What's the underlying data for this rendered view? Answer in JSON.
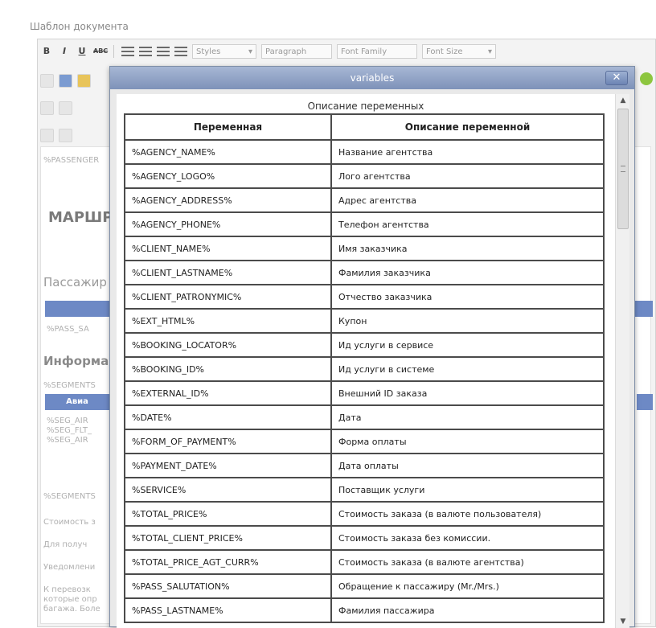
{
  "page": {
    "title": "Шаблон документа"
  },
  "toolbar": {
    "bold": "B",
    "italic": "I",
    "underline": "U",
    "strike": "ABC",
    "styles": "Styles",
    "paragraph": "Paragraph",
    "font_family": "Font Family",
    "font_size": "Font Size"
  },
  "editor": {
    "var_passenger": "%PASSENGER",
    "heading_route": "МАРШР",
    "heading_passengers": "Пассажир",
    "var_pass_sa": "%PASS_SA",
    "heading_info": "Информац",
    "var_segments": "%SEGMENTS",
    "col_flight": "Авиа",
    "var_seg_air": "%SEG_AIR",
    "var_seg_flt": "%SEG_FLT_",
    "var_seg_air2": "%SEG_AIR",
    "var_segments2": "%SEGMENTS",
    "text_cost": "Стоимость з",
    "text_get": "Для получ",
    "text_notice": "Уведомлени",
    "text_carrier": "К перевозк",
    "text_which": "которые опр",
    "text_baggage": "багажа. Боле"
  },
  "modal": {
    "title": "variables",
    "close": "✕",
    "caption": "Описание переменных",
    "headers": [
      "Переменная",
      "Описание переменной"
    ],
    "rows": [
      [
        "%AGENCY_NAME%",
        "Название агентства"
      ],
      [
        "%AGENCY_LOGO%",
        "Лого агентства"
      ],
      [
        "%AGENCY_ADDRESS%",
        "Адрес агентства"
      ],
      [
        "%AGENCY_PHONE%",
        "Телефон агентства"
      ],
      [
        "%CLIENT_NAME%",
        "Имя заказчика"
      ],
      [
        "%CLIENT_LASTNAME%",
        "Фамилия заказчика"
      ],
      [
        "%CLIENT_PATRONYMIC%",
        "Отчество заказчика"
      ],
      [
        "%EXT_HTML%",
        "Купон"
      ],
      [
        "%BOOKING_LOCATOR%",
        "Ид услуги в сервисе"
      ],
      [
        "%BOOKING_ID%",
        "Ид услуги в системе"
      ],
      [
        "%EXTERNAL_ID%",
        "Внешний ID заказа"
      ],
      [
        "%DATE%",
        "Дата"
      ],
      [
        "%FORM_OF_PAYMENT%",
        "Форма оплаты"
      ],
      [
        "%PAYMENT_DATE%",
        "Дата оплаты"
      ],
      [
        "%SERVICE%",
        "Поставщик услуги"
      ],
      [
        "%TOTAL_PRICE%",
        "Стоимость заказа (в валюте пользователя)"
      ],
      [
        "%TOTAL_CLIENT_PRICE%",
        "Стоимость заказа без комиссии."
      ],
      [
        "%TOTAL_PRICE_AGT_CURR%",
        "Стоимость заказа (в валюте агентства)"
      ],
      [
        "%PASS_SALUTATION%",
        "Обращение к пассажиру (Mr./Mrs.)"
      ],
      [
        "%PASS_LASTNAME%",
        "Фамилия пассажира"
      ]
    ]
  }
}
